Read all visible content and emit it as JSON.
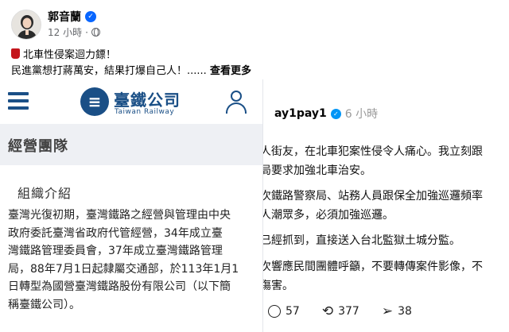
{
  "post": {
    "author": "郭音蘭",
    "time": "12 小時",
    "line1": "北車性侵案迴力鏢！",
    "line2": "民進黨想打蔣萬安，結果打爆自己人！......",
    "see_more": "查看更多"
  },
  "threads": {
    "username": "ay1pay1",
    "time": "6 小時",
    "lines": [
      "人街友，在北車犯案性侵令人痛心。我立刻跟",
      "局要求加強北車治安。",
      "次鐵路警察局、站務人員跟保全加強巡邏頻率",
      "人潮眾多，必須加強巡邏。",
      "已經抓到，直接送入台北監獄土城分監。",
      "次響應民間團體呼籲，不要轉傳案件影像，不",
      "傷害。"
    ],
    "actions": {
      "comments": "57",
      "reposts": "377",
      "shares": "38"
    }
  },
  "railway": {
    "logo_glyph": "≡",
    "title": "臺鐵公司",
    "subtitle": "Taiwan Railway",
    "section": "經營團隊",
    "heading": "組織介紹",
    "body_lines": [
      "臺灣光復初期，臺灣鐵路之經營與管理由中央",
      "政府委託臺灣省政府代管經營，34年成立臺",
      "灣鐵路管理委員會，37年成立臺灣鐵路管理",
      "局，88年7月1日起隸屬交通部，於113年1月1",
      "日轉型為國營臺灣鐵路股份有限公司（以下簡",
      "稱臺鐵公司）。"
    ]
  },
  "colors": {
    "fb_blue": "#0866ff",
    "railway_blue": "#1a4f86",
    "muted_gray": "#65676b"
  }
}
